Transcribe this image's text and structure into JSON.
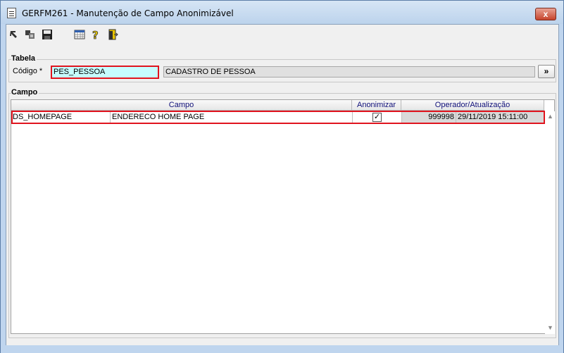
{
  "window": {
    "title": "GERFM261 - Manutenção de Campo Anonimizável",
    "close_label": "x"
  },
  "toolbar": {
    "icons": [
      "first-record-icon",
      "copy-record-icon",
      "save-icon",
      "calendar-grid-icon",
      "help-icon",
      "exit-door-icon"
    ]
  },
  "tabela": {
    "group_title": "Tabela",
    "codigo_label": "Código *",
    "codigo_value": "PES_PESSOA",
    "descricao_value": "CADASTRO DE PESSOA",
    "lookup_label": "»"
  },
  "campo": {
    "group_title": "Campo",
    "columns": {
      "campo": "Campo",
      "anonimizar": "Anonimizar",
      "operador": "Operador/Atualização"
    },
    "rows": [
      {
        "nome": "DS_HOMEPAGE",
        "descricao": "ENDERECO HOME PAGE",
        "anonimizar": true,
        "operador": "999998",
        "atualizacao": "29/11/2019 15:11:00"
      }
    ]
  },
  "colors": {
    "highlight_border": "#e0141e",
    "input_bg": "#c6fcfe",
    "header_text": "#10107a"
  }
}
